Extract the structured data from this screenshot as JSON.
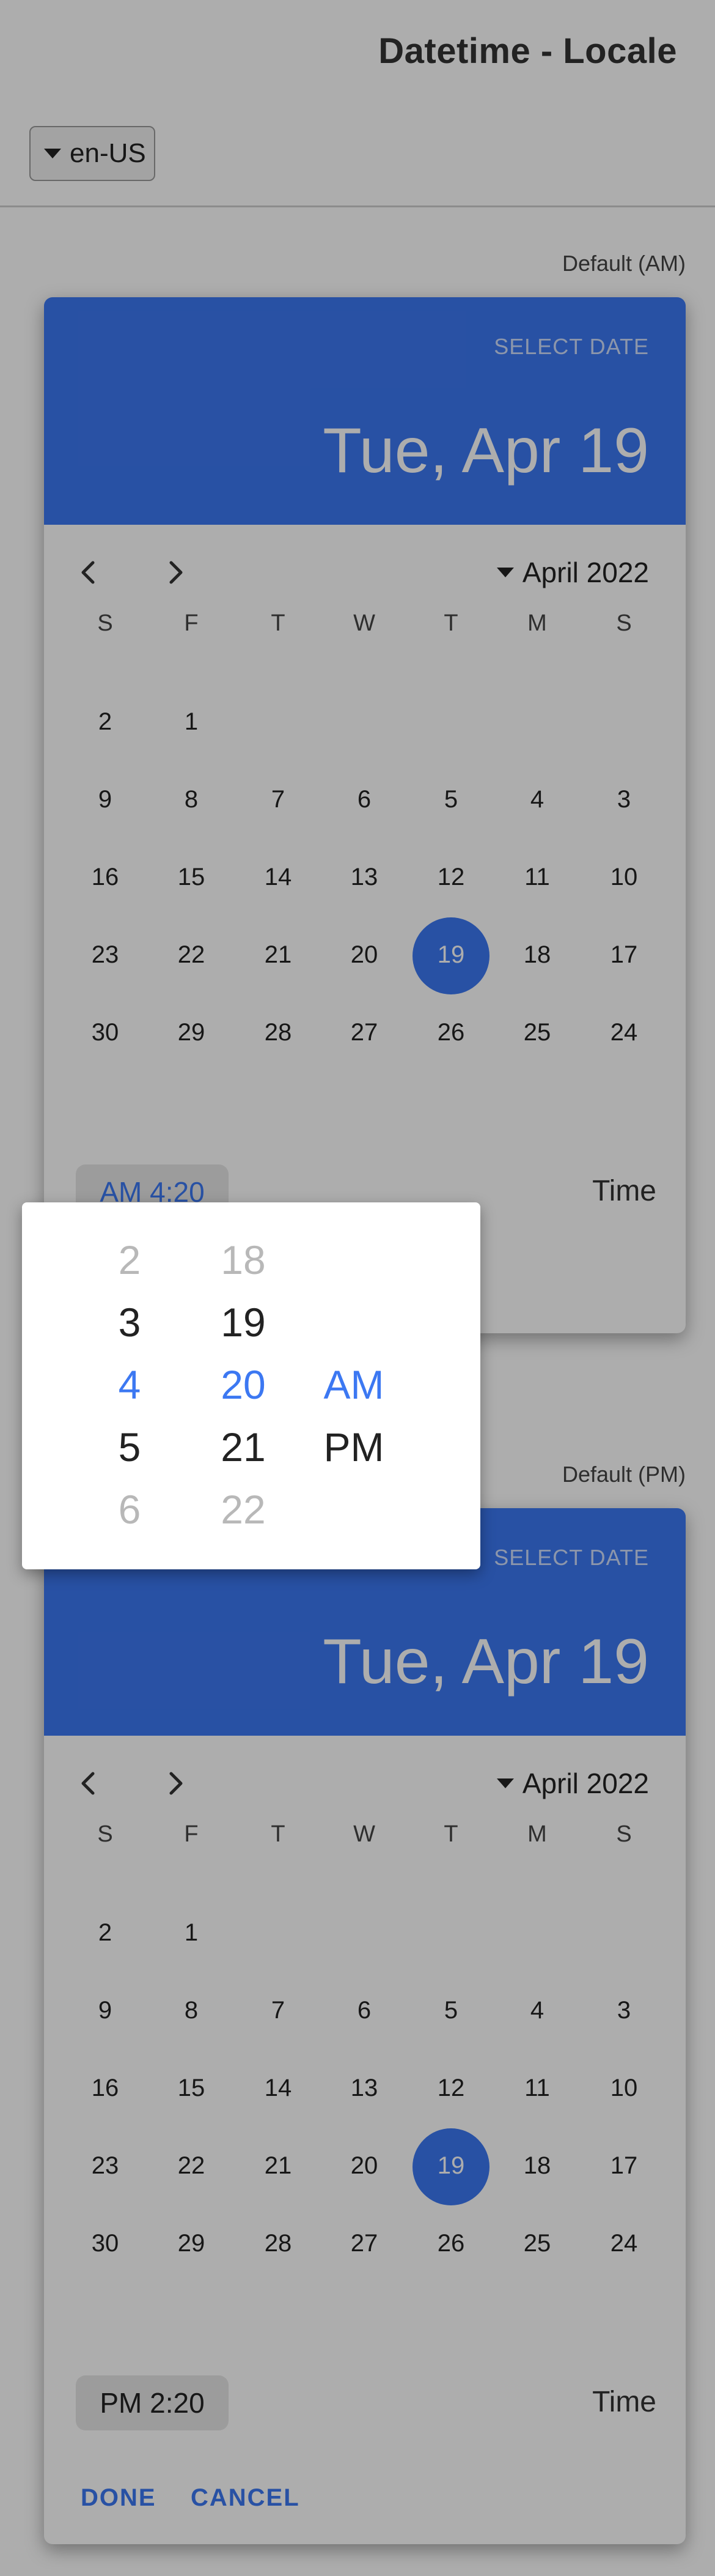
{
  "header": {
    "title": "Datetime - Locale",
    "locale": "en-US"
  },
  "colors": {
    "accent": "#3c78f2",
    "overlay": "rgba(0,0,0,0.32)"
  },
  "picker_am": {
    "caption": "Default (AM)",
    "select_label": "SELECT DATE",
    "selected_date": "Tue, Apr 19",
    "month_label": "April 2022",
    "weekdays": [
      "S",
      "F",
      "T",
      "W",
      "T",
      "M",
      "S"
    ],
    "weeks": [
      [
        "2",
        "1",
        "",
        "",
        "",
        "",
        ""
      ],
      [
        "9",
        "8",
        "7",
        "6",
        "5",
        "4",
        "3"
      ],
      [
        "16",
        "15",
        "14",
        "13",
        "12",
        "11",
        "10"
      ],
      [
        "23",
        "22",
        "21",
        "20",
        "19",
        "18",
        "17"
      ],
      [
        "30",
        "29",
        "28",
        "27",
        "26",
        "25",
        "24"
      ]
    ],
    "selected_day": "19",
    "time_value": "AM 4:20",
    "time_label": "Time"
  },
  "picker_pm": {
    "caption": "Default (PM)",
    "select_label": "SELECT DATE",
    "selected_date": "Tue, Apr 19",
    "month_label": "April 2022",
    "weekdays": [
      "S",
      "F",
      "T",
      "W",
      "T",
      "M",
      "S"
    ],
    "weeks": [
      [
        "2",
        "1",
        "",
        "",
        "",
        "",
        ""
      ],
      [
        "9",
        "8",
        "7",
        "6",
        "5",
        "4",
        "3"
      ],
      [
        "16",
        "15",
        "14",
        "13",
        "12",
        "11",
        "10"
      ],
      [
        "23",
        "22",
        "21",
        "20",
        "19",
        "18",
        "17"
      ],
      [
        "30",
        "29",
        "28",
        "27",
        "26",
        "25",
        "24"
      ]
    ],
    "selected_day": "19",
    "time_value": "PM 2:20",
    "time_label": "Time",
    "done_label": "DONE",
    "cancel_label": "CANCEL"
  },
  "time_spinner": {
    "hours": [
      "2",
      "3",
      "4",
      "5",
      "6"
    ],
    "minutes": [
      "18",
      "19",
      "20",
      "21",
      "22"
    ],
    "selected_hour": "4",
    "selected_minute": "20",
    "periods": [
      "AM",
      "PM"
    ],
    "selected_period": "AM"
  }
}
